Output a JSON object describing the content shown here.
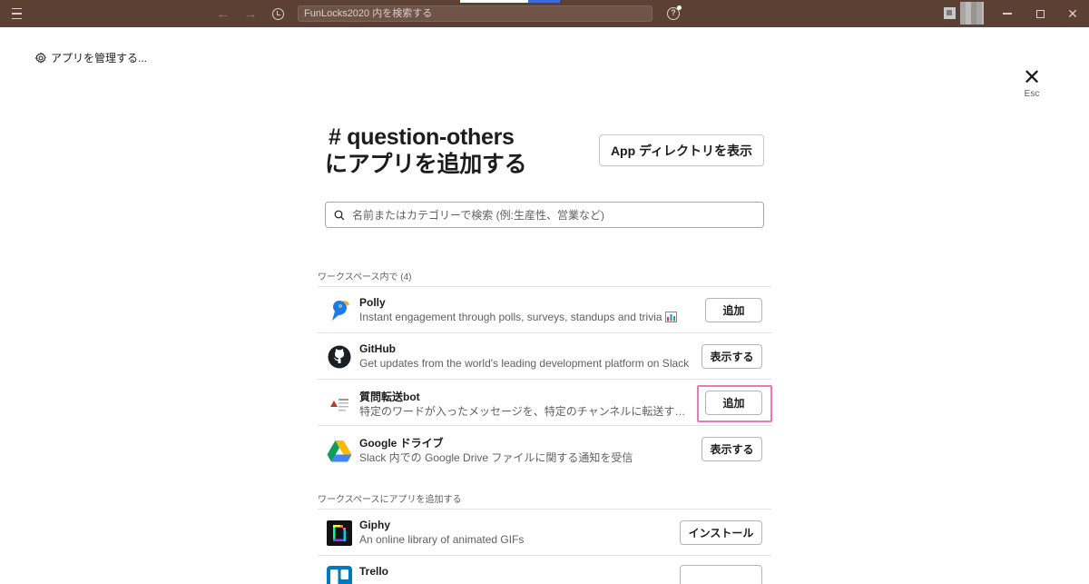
{
  "topbar": {
    "search_placeholder": "FunLocks2020 内を検索する",
    "back_glyph": "←",
    "forward_glyph": "→",
    "help_glyph": "?",
    "close_glyph": "✕",
    "accent": "#5c4033"
  },
  "manage": {
    "label": "アプリを管理する..."
  },
  "esc": {
    "glyph": "✕",
    "label": "Esc"
  },
  "heading": {
    "line1": "# question-others",
    "line2": "にアプリを追加する"
  },
  "directory_button": {
    "label": "App ディレクトリを表示"
  },
  "search": {
    "placeholder": "名前またはカテゴリーで検索 (例:生産性、営業など)"
  },
  "sections": {
    "in_workspace": {
      "label": "ワークスペース内で (4)"
    },
    "add_to_workspace": {
      "label": "ワークスペースにアプリを追加する"
    }
  },
  "apps": [
    {
      "name": "Polly",
      "desc": "Instant engagement through polls, surveys, standups and trivia",
      "button": "追加",
      "icon": "polly-icon"
    },
    {
      "name": "GitHub",
      "desc": "Get updates from the world's leading development platform on Slack",
      "button": "表示する",
      "icon": "github-icon"
    },
    {
      "name": "質問転送bot",
      "desc": "特定のワードが入ったメッセージを、特定のチャンネルに転送するbot",
      "button": "追加",
      "icon": "bot-icon"
    },
    {
      "name": "Google ドライブ",
      "desc": "Slack 内での Google Drive ファイルに関する通知を受信",
      "button": "表示する",
      "icon": "google-drive-icon"
    },
    {
      "name": "Giphy",
      "desc": "An online library of animated GIFs",
      "button": "インストール",
      "icon": "giphy-icon"
    },
    {
      "name": "Trello",
      "desc": "",
      "button": "",
      "icon": "trello-icon"
    }
  ],
  "highlight_color": "#e879b5"
}
